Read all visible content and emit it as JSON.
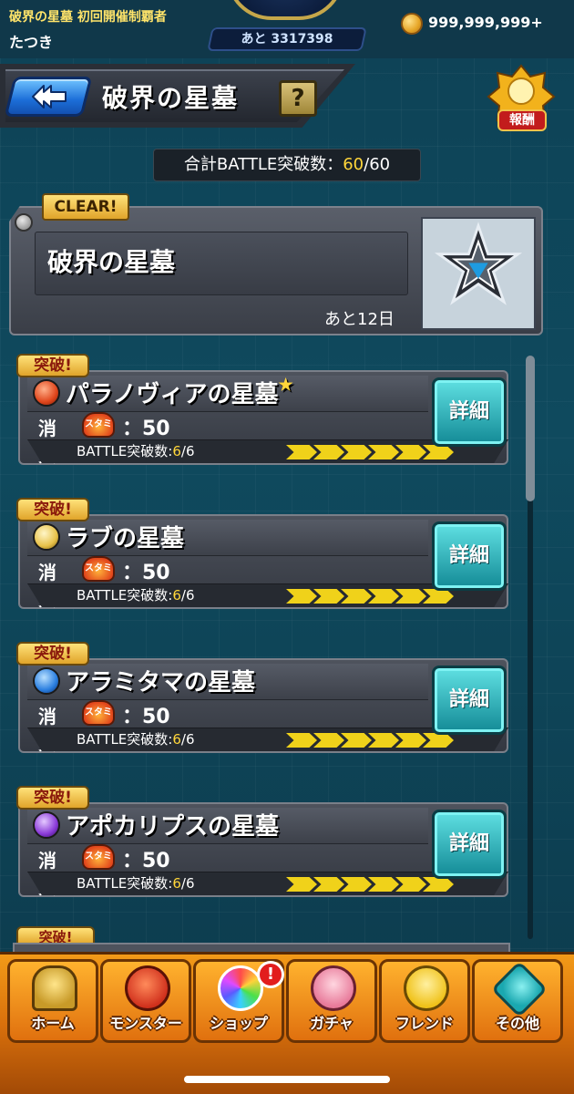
{
  "status": {
    "event_title": "破界の星墓 初回開催制覇者",
    "user_name": "たつき",
    "exp_remaining": "あと 3317398",
    "coins": "999,999,999+"
  },
  "header": {
    "title": "破界の星墓",
    "help_label": "?",
    "reward_label": "報酬"
  },
  "total": {
    "label": "合計BATTLE突破数：",
    "current": "60",
    "separator": "/",
    "max": "60"
  },
  "feature": {
    "clear_label": "CLEAR!",
    "title": "破界の星墓",
    "remaining": "あと12日"
  },
  "quests": [
    {
      "tag": "突破!",
      "name": "パラノヴィアの星墓",
      "star": "★",
      "icon_color": "#e0461c",
      "stamina_label": "消費",
      "stamina_icon_text": "スタミナ",
      "stamina_value": "：50",
      "battle_label": "BATTLE突破数:",
      "battle_current": "6",
      "battle_max": "/6",
      "progress": 1.0,
      "detail_label": "詳細"
    },
    {
      "tag": "突破!",
      "name": "ラブの星墓",
      "star": "",
      "icon_color": "#e8c24a",
      "stamina_label": "消費",
      "stamina_icon_text": "スタミナ",
      "stamina_value": "：50",
      "battle_label": "BATTLE突破数:",
      "battle_current": "6",
      "battle_max": "/6",
      "progress": 1.0,
      "detail_label": "詳細"
    },
    {
      "tag": "突破!",
      "name": "アラミタマの星墓",
      "star": "",
      "icon_color": "#2b7fe0",
      "stamina_label": "消費",
      "stamina_icon_text": "スタミナ",
      "stamina_value": "：50",
      "battle_label": "BATTLE突破数:",
      "battle_current": "6",
      "battle_max": "/6",
      "progress": 1.0,
      "detail_label": "詳細"
    },
    {
      "tag": "突破!",
      "name": "アポカリプスの星墓",
      "star": "",
      "icon_color": "#8a3ad8",
      "stamina_label": "消費",
      "stamina_icon_text": "スタミナ",
      "stamina_value": "：50",
      "battle_label": "BATTLE突破数:",
      "battle_current": "6",
      "battle_max": "/6",
      "progress": 1.0,
      "detail_label": "詳細"
    }
  ],
  "partial_tag": "突破!",
  "nav": [
    {
      "label": "ホーム",
      "icon": "home-gate-icon"
    },
    {
      "label": "モンスター",
      "icon": "monster-icon"
    },
    {
      "label": "ショップ",
      "icon": "rainbow-orb-icon"
    },
    {
      "label": "ガチャ",
      "icon": "gacha-character-icon"
    },
    {
      "label": "フレンド",
      "icon": "friends-icon"
    },
    {
      "label": "その他",
      "icon": "other-menu-icon"
    }
  ],
  "shop_badge": "!",
  "colors": {
    "accent_yellow": "#ffd63a",
    "detail_teal": "#138a96",
    "nav_orange": "#e0700e",
    "back_blue": "#1c6ed8"
  }
}
